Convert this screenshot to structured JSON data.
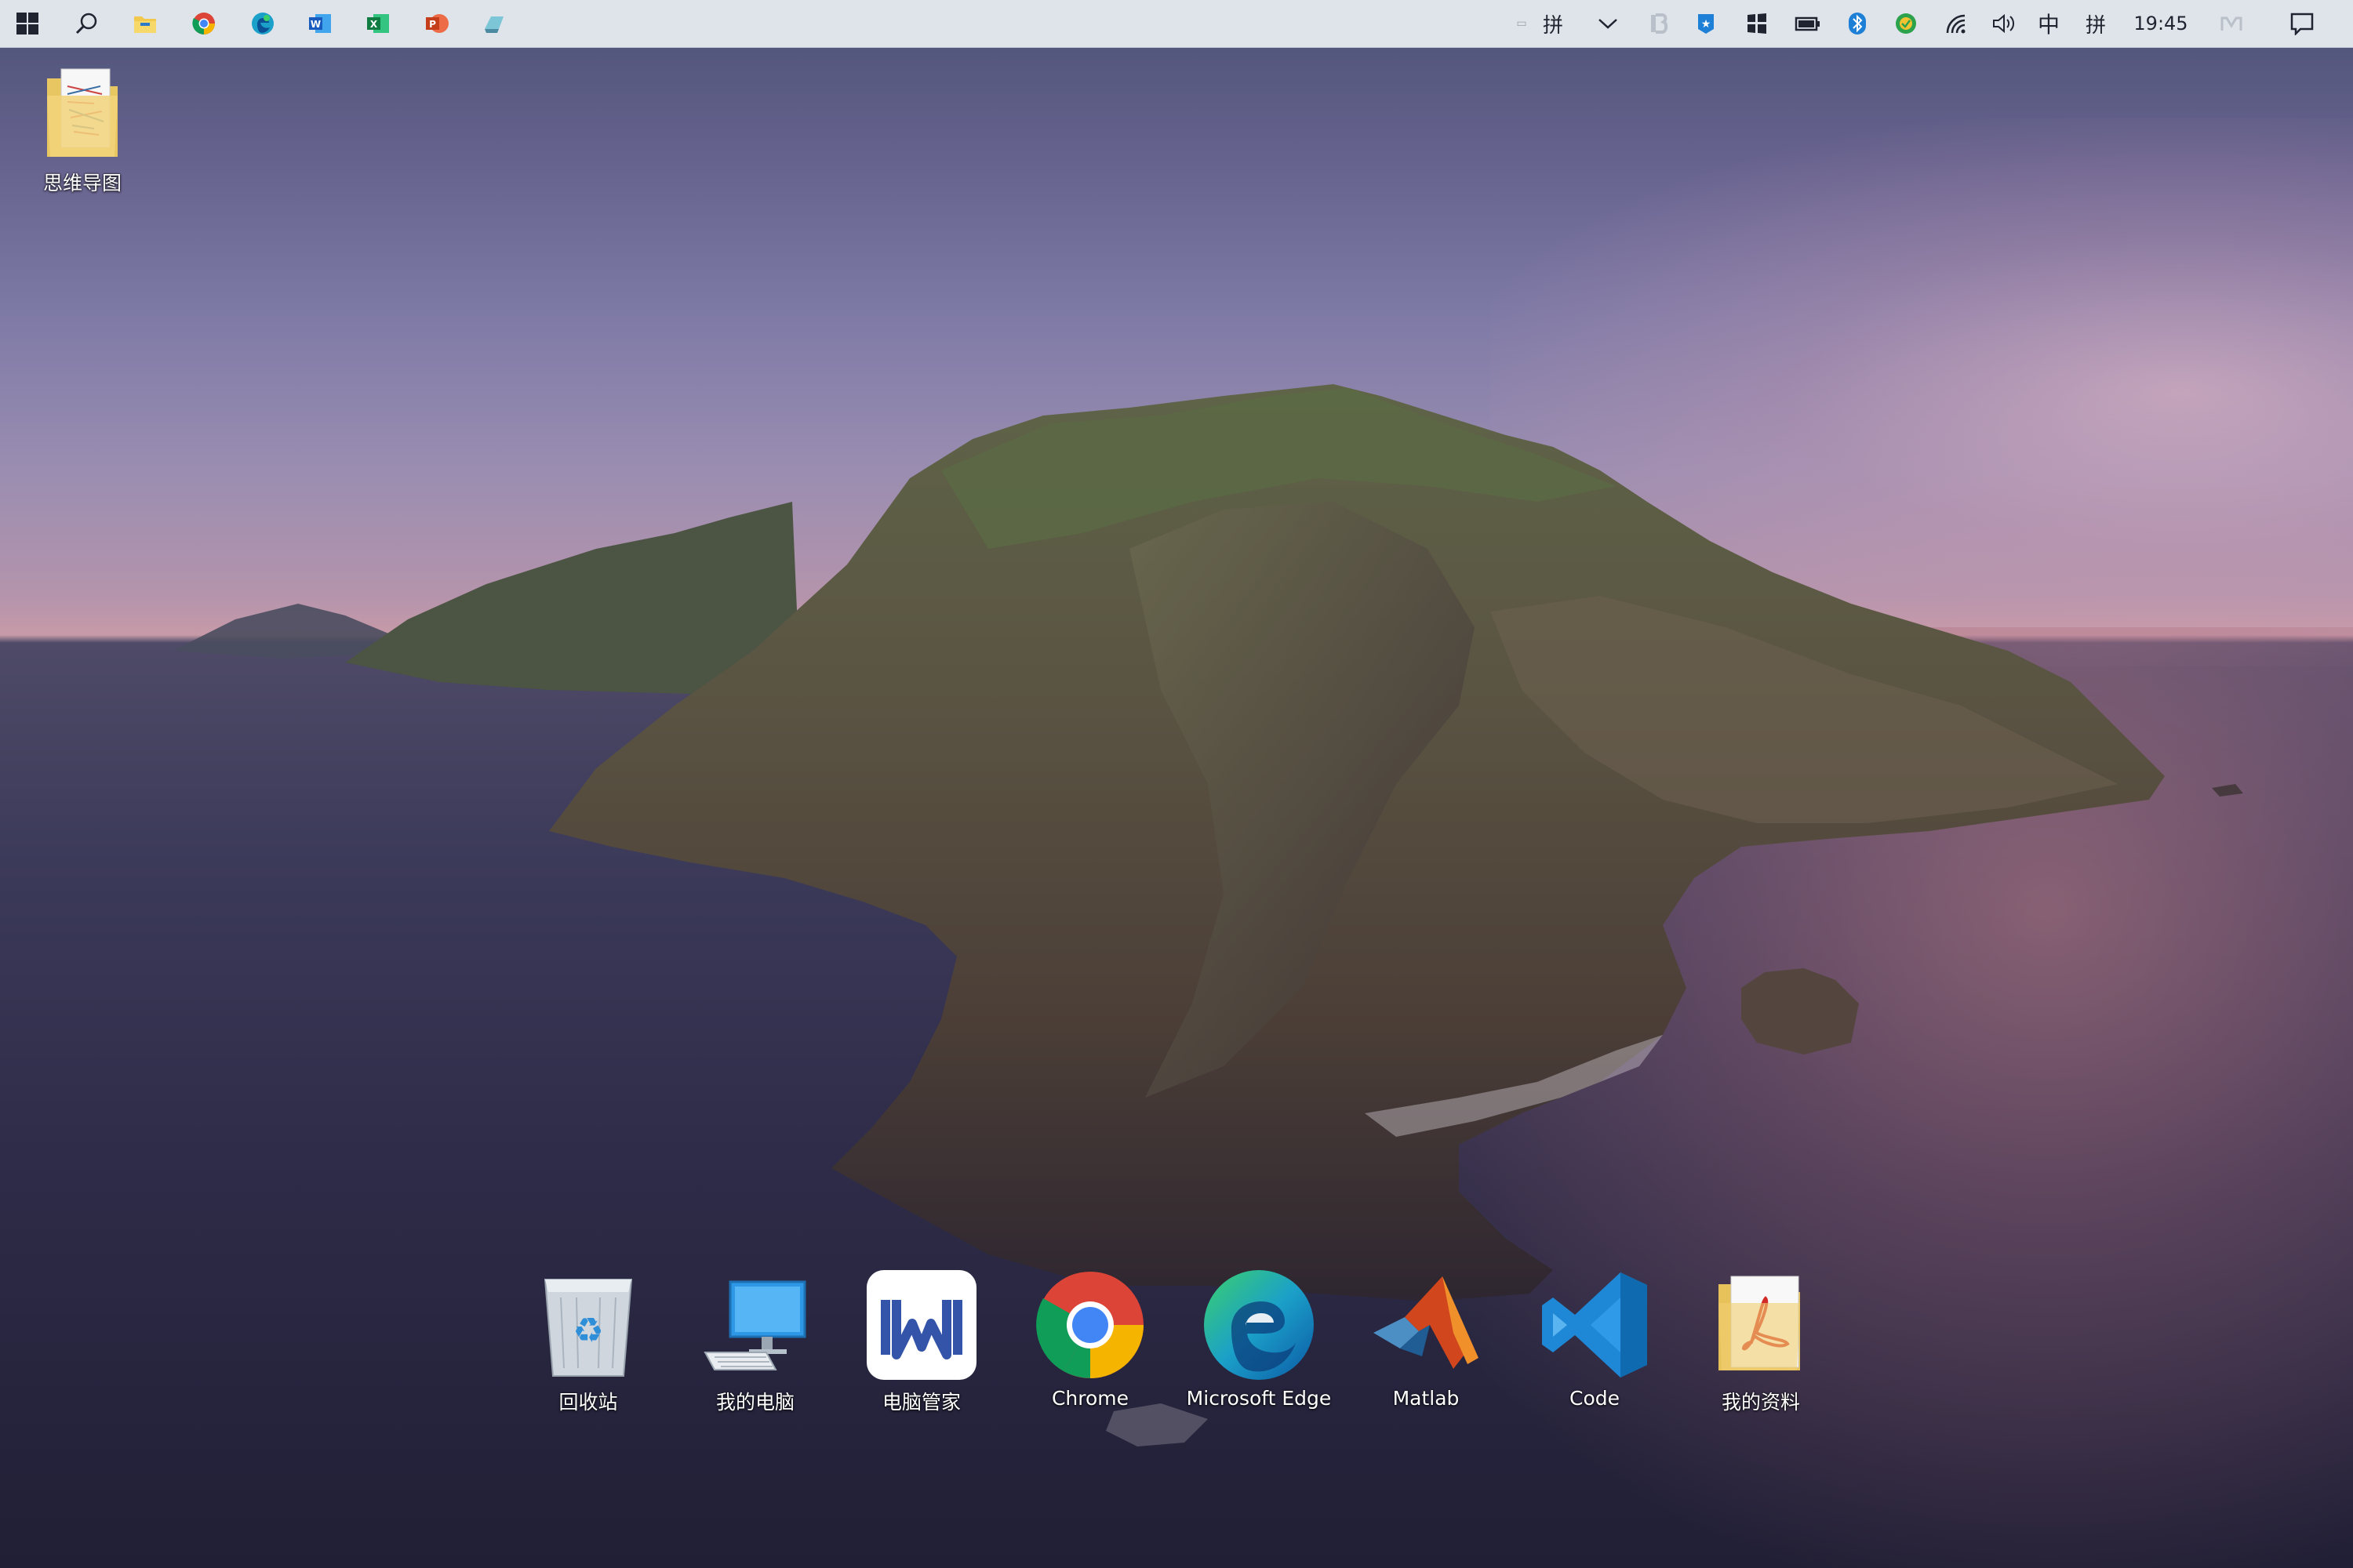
{
  "taskbar": {
    "pinned": [
      {
        "name": "start-icon"
      },
      {
        "name": "search-icon"
      },
      {
        "name": "file-explorer-icon"
      },
      {
        "name": "chrome-icon"
      },
      {
        "name": "edge-icon"
      },
      {
        "name": "word-icon"
      },
      {
        "name": "excel-icon"
      },
      {
        "name": "powerpoint-icon"
      },
      {
        "name": "app-icon"
      }
    ],
    "tray": {
      "ime_label_1": "拼",
      "ime_lang": "中",
      "ime_label_2": "拼",
      "clock": "19:45"
    }
  },
  "desktop": {
    "top_icon": {
      "label": "思维导图"
    },
    "dock": [
      {
        "label": "回收站",
        "icon": "recycle-bin-icon"
      },
      {
        "label": "我的电脑",
        "icon": "computer-icon"
      },
      {
        "label": "电脑管家",
        "icon": "pc-manager-icon"
      },
      {
        "label": "Chrome",
        "icon": "chrome-icon"
      },
      {
        "label": "Microsoft Edge",
        "icon": "edge-icon"
      },
      {
        "label": "Matlab",
        "icon": "matlab-icon"
      },
      {
        "label": "Code",
        "icon": "vscode-icon"
      },
      {
        "label": "我的资料",
        "icon": "pdf-folder-icon"
      }
    ]
  },
  "colors": {
    "taskbar_bg": "#dfe3ea",
    "text_light": "#ffffff",
    "text_dark": "#1f2430"
  }
}
